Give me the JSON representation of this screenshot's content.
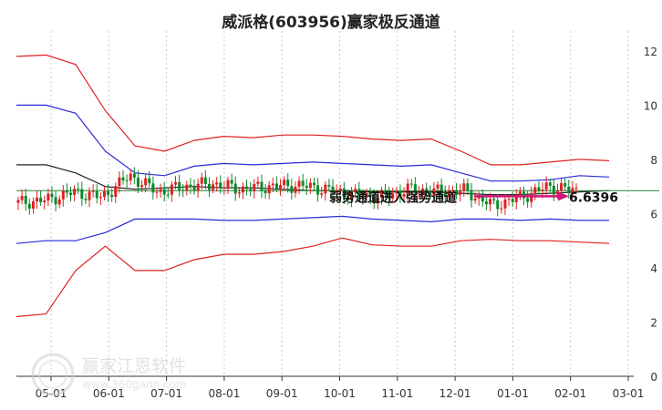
{
  "chart_data": {
    "type": "line",
    "title": "威派格(603956)赢家极反通道",
    "ylim": [
      0,
      12.4
    ],
    "y_ticks": [
      "0",
      "2",
      "4",
      "6",
      "8",
      "10",
      "12"
    ],
    "x_ticks": [
      "05-01",
      "06-01",
      "07-01",
      "08-01",
      "09-01",
      "10-01",
      "11-01",
      "12-01",
      "01-01",
      "02-01",
      "03-01"
    ],
    "annotation": {
      "text": "弱势通道进入强势通道",
      "value_label": "6.6396",
      "value": 6.64
    },
    "grid": "vertical dotted",
    "series": [
      {
        "key": "outer_upper",
        "color": "#e02020",
        "values": [
          11.8,
          11.85,
          11.5,
          9.8,
          8.5,
          8.3,
          8.7,
          8.85,
          8.8,
          8.9,
          8.9,
          8.85,
          8.75,
          8.7,
          8.75,
          8.3,
          7.8,
          7.8,
          7.9,
          8.0,
          7.95
        ]
      },
      {
        "key": "inner_upper",
        "color": "#2a2ad6",
        "values": [
          10.0,
          10.0,
          9.7,
          8.3,
          7.5,
          7.4,
          7.75,
          7.85,
          7.8,
          7.85,
          7.9,
          7.85,
          7.8,
          7.75,
          7.8,
          7.5,
          7.2,
          7.2,
          7.25,
          7.4,
          7.35
        ]
      },
      {
        "key": "mid_line",
        "color": "#222222",
        "values": [
          7.8,
          7.8,
          7.5,
          7.0,
          6.9,
          6.95,
          7.0,
          6.95,
          6.95,
          6.9,
          6.85,
          6.85,
          6.8,
          6.8,
          6.8,
          6.75,
          6.7,
          6.7,
          6.75,
          6.8,
          6.85
        ]
      },
      {
        "key": "inner_lower",
        "color": "#2a2ad6",
        "values": [
          4.9,
          5.0,
          5.0,
          5.3,
          5.8,
          5.8,
          5.8,
          5.75,
          5.75,
          5.8,
          5.85,
          5.9,
          5.8,
          5.75,
          5.7,
          5.8,
          5.8,
          5.75,
          5.8,
          5.75,
          5.75
        ]
      },
      {
        "key": "outer_lower",
        "color": "#e02020",
        "values": [
          2.2,
          2.3,
          3.9,
          4.8,
          3.9,
          3.9,
          4.3,
          4.5,
          4.5,
          4.6,
          4.8,
          5.1,
          4.85,
          4.8,
          4.8,
          5.0,
          5.05,
          5.0,
          5.0,
          4.95,
          4.9
        ]
      },
      {
        "key": "price",
        "color": "#d8131d",
        "values": [
          6.4,
          6.5,
          6.8,
          6.6,
          7.4,
          6.8,
          7.0,
          7.1,
          6.9,
          7.0,
          7.05,
          6.9,
          6.7,
          6.6,
          6.9,
          6.8,
          6.85,
          6.3,
          6.6,
          7.0,
          6.85
        ]
      },
      {
        "key": "target_line",
        "color": "#2e7d32",
        "values": [
          6.85,
          6.85,
          6.85,
          6.85,
          6.85,
          6.85,
          6.85,
          6.85,
          6.85,
          6.85,
          6.85,
          6.85,
          6.85,
          6.85,
          6.85,
          6.85,
          6.85,
          6.85,
          6.85,
          6.85,
          6.85
        ]
      }
    ]
  },
  "watermark": {
    "brand": "赢家江恩软件",
    "url": "www.360gann.com"
  }
}
